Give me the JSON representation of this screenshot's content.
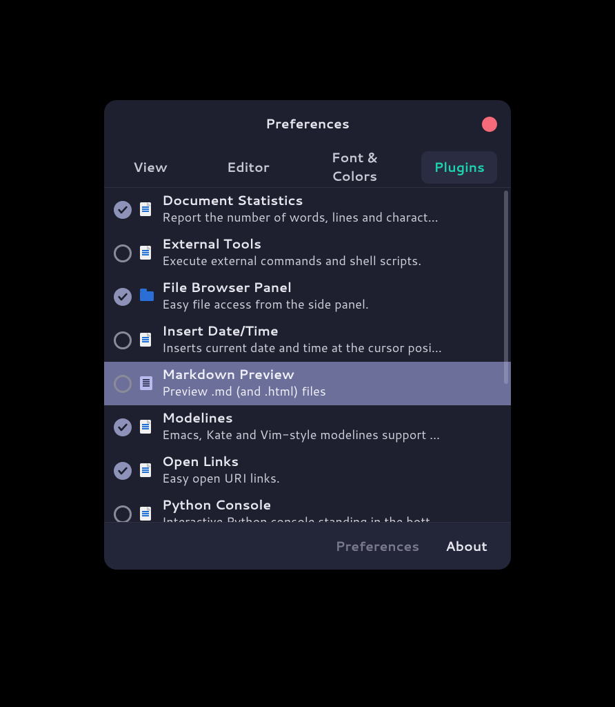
{
  "window": {
    "title": "Preferences"
  },
  "tabs": [
    {
      "label": "View",
      "active": false
    },
    {
      "label": "Editor",
      "active": false
    },
    {
      "label": "Font & Colors",
      "active": false
    },
    {
      "label": "Plugins",
      "active": true
    }
  ],
  "plugins": [
    {
      "name": "Document Statistics",
      "description": "Report the number of words, lines and charact…",
      "checked": true,
      "icon": "file",
      "selected": false
    },
    {
      "name": "External Tools",
      "description": "Execute external commands and shell scripts.",
      "checked": false,
      "icon": "file",
      "selected": false
    },
    {
      "name": "File Browser Panel",
      "description": "Easy file access from the side panel.",
      "checked": true,
      "icon": "folder",
      "selected": false
    },
    {
      "name": "Insert Date/Time",
      "description": "Inserts current date and time at the cursor posi…",
      "checked": false,
      "icon": "file",
      "selected": false
    },
    {
      "name": "Markdown Preview",
      "description": "Preview .md (and .html) files",
      "checked": false,
      "icon": "md",
      "selected": true
    },
    {
      "name": "Modelines",
      "description": "Emacs, Kate and Vim-style modelines support …",
      "checked": true,
      "icon": "file",
      "selected": false
    },
    {
      "name": "Open Links",
      "description": "Easy open URI links.",
      "checked": true,
      "icon": "file",
      "selected": false
    },
    {
      "name": "Python Console",
      "description": "Interactive Python console standing in the bott…",
      "checked": false,
      "icon": "file",
      "selected": false
    }
  ],
  "footer": {
    "preferences_label": "Preferences",
    "about_label": "About"
  }
}
